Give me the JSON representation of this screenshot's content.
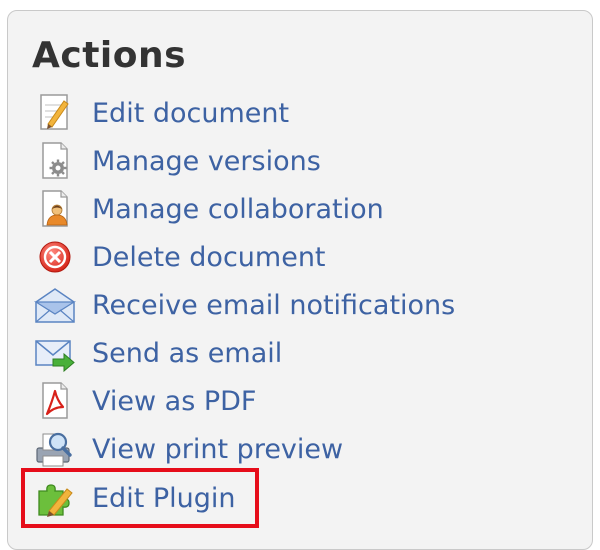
{
  "actions": {
    "title": "Actions",
    "items": [
      {
        "label": "Edit document",
        "icon": "pencil-document-icon"
      },
      {
        "label": "Manage versions",
        "icon": "document-gear-icon"
      },
      {
        "label": "Manage collaboration",
        "icon": "document-person-icon"
      },
      {
        "label": "Delete document",
        "icon": "red-x-circle-icon"
      },
      {
        "label": "Receive email notifications",
        "icon": "envelope-open-icon"
      },
      {
        "label": "Send as email",
        "icon": "envelope-arrow-icon"
      },
      {
        "label": "View as PDF",
        "icon": "pdf-icon"
      },
      {
        "label": "View print preview",
        "icon": "print-preview-icon"
      },
      {
        "label": "Edit Plugin",
        "icon": "puzzle-pencil-icon"
      }
    ],
    "highlighted_item": "Edit Plugin",
    "colors": {
      "link": "#3d62a3",
      "title": "#333333",
      "panel_background": "#f3f3f3",
      "highlight_border": "#e60d1a"
    }
  }
}
